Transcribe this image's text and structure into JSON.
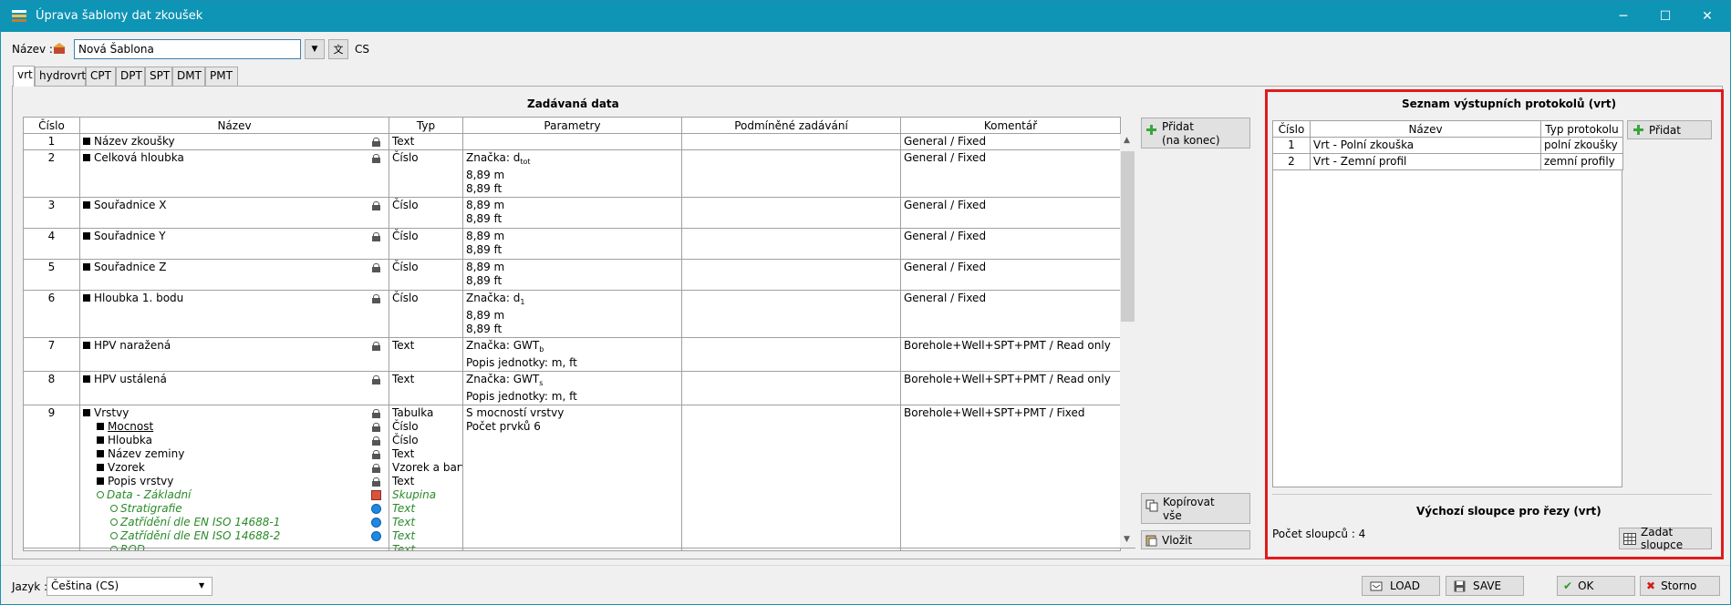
{
  "window": {
    "title": "Úprava šablony dat zkoušek"
  },
  "header": {
    "name_label": "Název :",
    "name_value": "Nová Šablona",
    "lang_code": "CS"
  },
  "tabs": [
    {
      "label": "vrt"
    },
    {
      "label": "hydrovrt"
    },
    {
      "label": "CPT"
    },
    {
      "label": "DPT"
    },
    {
      "label": "SPT"
    },
    {
      "label": "DMT"
    },
    {
      "label": "PMT"
    }
  ],
  "input_data": {
    "title": "Zadávaná data",
    "columns": [
      "Číslo",
      "Název",
      "Typ",
      "Parametry",
      "Podmíněné zadávání",
      "Komentář"
    ],
    "rows": [
      {
        "num": "1",
        "name": "Název zkoušky",
        "type": "Text",
        "comment": "General / Fixed"
      },
      {
        "num": "2",
        "name": "Celková hloubka",
        "type": "Číslo",
        "p1": "Značka: d",
        "p1sub": "tot",
        "p2": "8,89 m",
        "p3": "8,89 ft",
        "comment": "General / Fixed"
      },
      {
        "num": "3",
        "name": "Souřadnice X",
        "type": "Číslo",
        "p1": "8,89 m",
        "p2": "8,89 ft",
        "comment": "General / Fixed"
      },
      {
        "num": "4",
        "name": "Souřadnice Y",
        "type": "Číslo",
        "p1": "8,89 m",
        "p2": "8,89 ft",
        "comment": "General / Fixed"
      },
      {
        "num": "5",
        "name": "Souřadnice Z",
        "type": "Číslo",
        "p1": "8,89 m",
        "p2": "8,89 ft",
        "comment": "General / Fixed"
      },
      {
        "num": "6",
        "name": "Hloubka 1. bodu",
        "type": "Číslo",
        "p1": "Značka: d",
        "p1sub": "1",
        "p2": "8,89 m",
        "p3": "8,89 ft",
        "comment": "General / Fixed"
      },
      {
        "num": "7",
        "name": "HPV naražená",
        "type": "Text",
        "p1": "Značka: GWT",
        "p1sub": "b",
        "p2": "Popis jednotky: m, ft",
        "comment": "Borehole+Well+SPT+PMT / Read only"
      },
      {
        "num": "8",
        "name": "HPV ustálená",
        "type": "Text",
        "p1": "Značka: GWT",
        "p1sub": "s",
        "p2": "Popis jednotky: m, ft",
        "comment": "Borehole+Well+SPT+PMT / Read only"
      },
      {
        "num": "9",
        "name": "Vrstvy",
        "type": "Tabulka",
        "p1": "S mocností vrstvy",
        "p2": "Počet prvků 6",
        "comment": "Borehole+Well+SPT+PMT / Fixed"
      }
    ],
    "subitems": [
      {
        "name": "Mocnost",
        "type": "Číslo"
      },
      {
        "name": "Hloubka",
        "type": "Číslo"
      },
      {
        "name": "Název zeminy",
        "type": "Text"
      },
      {
        "name": "Vzorek",
        "type": "Vzorek a barva"
      },
      {
        "name": "Popis vrstvy",
        "type": "Text"
      },
      {
        "name": "Data - Základní",
        "type": "Skupina"
      },
      {
        "name": "Stratigrafie",
        "type": "Text"
      },
      {
        "name": "Zatřídění dle EN ISO 14688-1",
        "type": "Text"
      },
      {
        "name": "Zatřídění dle EN ISO 14688-2",
        "type": "Text"
      },
      {
        "name": "ROD",
        "type": "Text"
      }
    ]
  },
  "buttons": {
    "add_line1": "Přidat",
    "add_line2": "(na konec)",
    "copy_line1": "Kopírovat",
    "copy_line2": "vše",
    "paste": "Vložit",
    "add_protocol": "Přidat",
    "set_columns": "Zadat sloupce",
    "load": "LOAD",
    "save": "SAVE",
    "ok": "OK",
    "cancel": "Storno"
  },
  "protocols": {
    "title": "Seznam výstupních protokolů (vrt)",
    "columns": [
      "Číslo",
      "Název",
      "Typ protokolu"
    ],
    "rows": [
      {
        "num": "1",
        "name": "Vrt - Polní zkouška",
        "type": "polní zkoušky"
      },
      {
        "num": "2",
        "name": "Vrt - Zemní profil",
        "type": "zemní profily"
      }
    ]
  },
  "columns_section": {
    "title": "Výchozí sloupce pro řezy (vrt)",
    "count_text": "Počet sloupců : 4"
  },
  "footer": {
    "lang_label": "Jazyk :",
    "lang_value": "Čeština (CS)"
  },
  "colors": {
    "titlebar": "#0e94b5",
    "highlight": "#e01b1b",
    "green_text": "#2a8a2a"
  }
}
